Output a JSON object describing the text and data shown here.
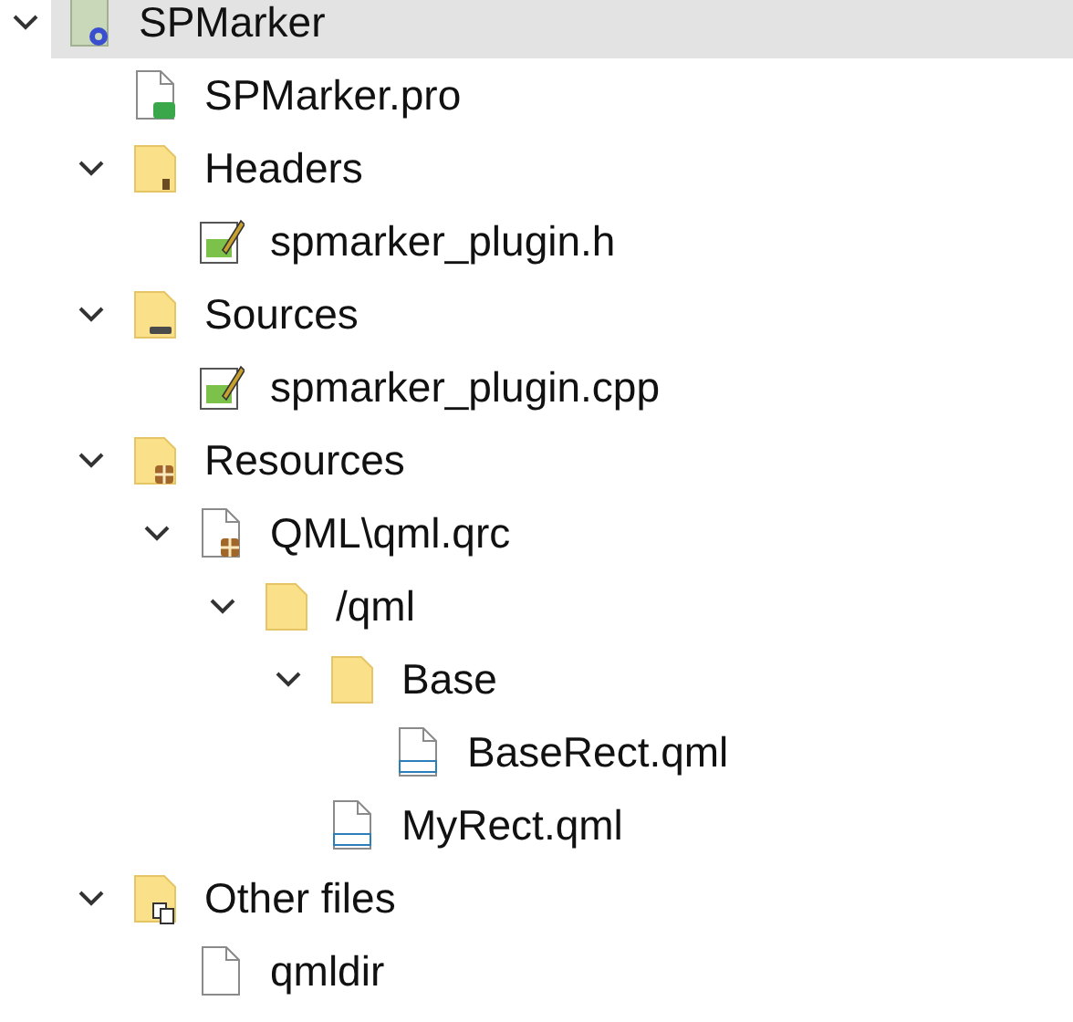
{
  "tree": [
    {
      "label": "SPMarker",
      "kind": "project",
      "expanded": true,
      "selected": true,
      "children": [
        {
          "label": "SPMarker.pro",
          "kind": "pro",
          "selected": false
        },
        {
          "label": "Headers",
          "kind": "folder-headers",
          "expanded": true,
          "selected": false,
          "children": [
            {
              "label": "spmarker_plugin.h",
              "kind": "source",
              "selected": false
            }
          ]
        },
        {
          "label": "Sources",
          "kind": "folder-sources",
          "expanded": true,
          "selected": false,
          "children": [
            {
              "label": "spmarker_plugin.cpp",
              "kind": "source",
              "selected": false
            }
          ]
        },
        {
          "label": "Resources",
          "kind": "folder-resources",
          "expanded": true,
          "selected": false,
          "children": [
            {
              "label": "QML\\qml.qrc",
              "kind": "qrc",
              "expanded": true,
              "selected": false,
              "children": [
                {
                  "label": "/qml",
                  "kind": "folder",
                  "expanded": true,
                  "selected": false,
                  "children": [
                    {
                      "label": "Base",
                      "kind": "folder",
                      "expanded": true,
                      "selected": false,
                      "children": [
                        {
                          "label": "BaseRect.qml",
                          "kind": "qml",
                          "selected": false
                        }
                      ]
                    },
                    {
                      "label": "MyRect.qml",
                      "kind": "qml",
                      "selected": false
                    }
                  ]
                }
              ]
            }
          ]
        },
        {
          "label": "Other files",
          "kind": "folder-other",
          "expanded": true,
          "selected": false,
          "children": [
            {
              "label": "qmldir",
              "kind": "file",
              "selected": false
            }
          ]
        }
      ]
    }
  ]
}
